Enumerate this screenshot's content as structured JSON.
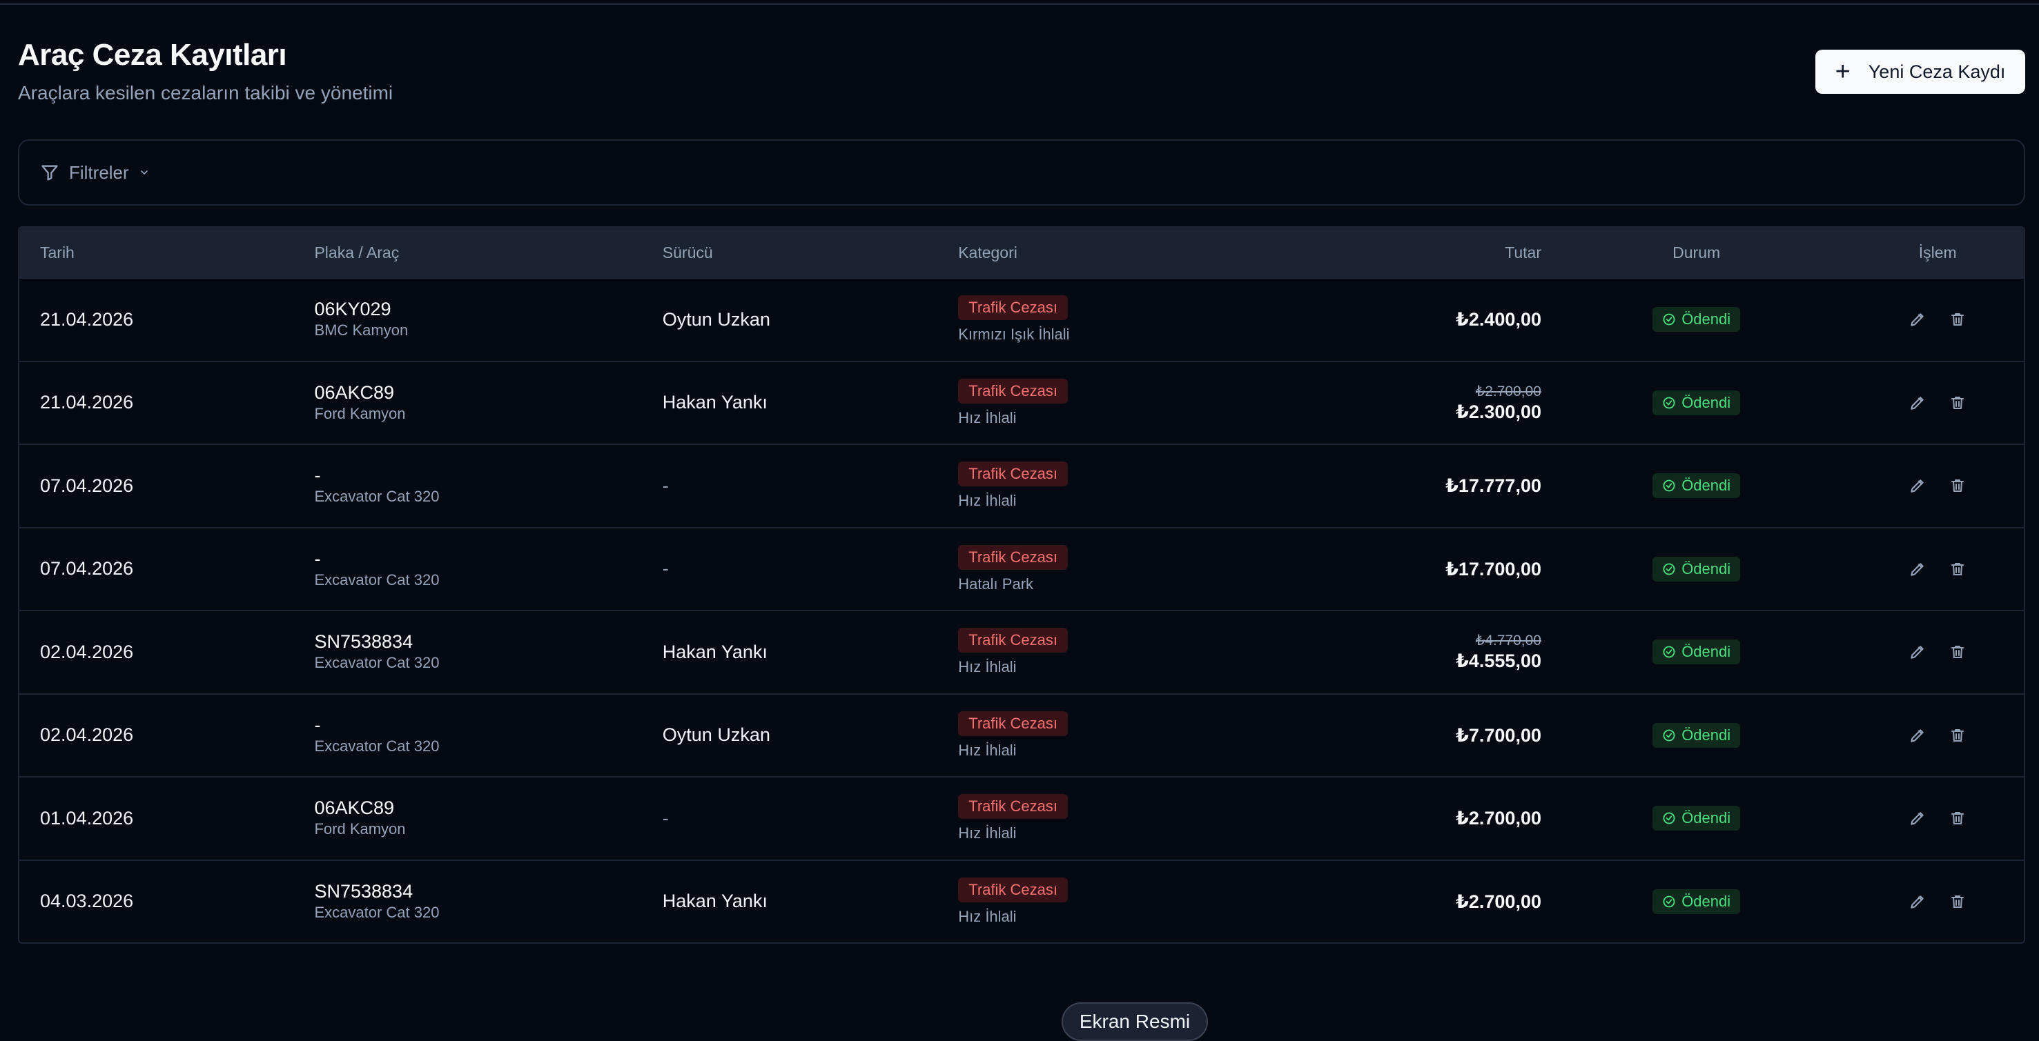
{
  "header": {
    "title": "Araç Ceza Kayıtları",
    "subtitle": "Araçlara kesilen cezaların takibi ve yönetimi",
    "new_button_label": "Yeni Ceza Kaydı"
  },
  "filters": {
    "label": "Filtreler"
  },
  "table": {
    "columns": [
      "Tarih",
      "Plaka / Araç",
      "Sürücü",
      "Kategori",
      "Tutar",
      "Durum",
      "İşlem"
    ],
    "rows": [
      {
        "date": "21.04.2026",
        "plate": "06KY029",
        "vehicle": "BMC Kamyon",
        "driver": "Oytun Uzkan",
        "category": "Trafik Cezası",
        "reason": "Kırmızı Işık İhlali",
        "old_amount": "",
        "amount": "₺2.400,00",
        "status": "Ödendi"
      },
      {
        "date": "21.04.2026",
        "plate": "06AKC89",
        "vehicle": "Ford Kamyon",
        "driver": "Hakan Yankı",
        "category": "Trafik Cezası",
        "reason": "Hız İhlali",
        "old_amount": "₺2.700,00",
        "amount": "₺2.300,00",
        "status": "Ödendi"
      },
      {
        "date": "07.04.2026",
        "plate": "-",
        "vehicle": "Excavator Cat 320",
        "driver": "-",
        "category": "Trafik Cezası",
        "reason": "Hız İhlali",
        "old_amount": "",
        "amount": "₺17.777,00",
        "status": "Ödendi"
      },
      {
        "date": "07.04.2026",
        "plate": "-",
        "vehicle": "Excavator Cat 320",
        "driver": "-",
        "category": "Trafik Cezası",
        "reason": "Hatalı Park",
        "old_amount": "",
        "amount": "₺17.700,00",
        "status": "Ödendi"
      },
      {
        "date": "02.04.2026",
        "plate": "SN7538834",
        "vehicle": "Excavator Cat 320",
        "driver": "Hakan Yankı",
        "category": "Trafik Cezası",
        "reason": "Hız İhlali",
        "old_amount": "₺4.770,00",
        "amount": "₺4.555,00",
        "status": "Ödendi"
      },
      {
        "date": "02.04.2026",
        "plate": "-",
        "vehicle": "Excavator Cat 320",
        "driver": "Oytun Uzkan",
        "category": "Trafik Cezası",
        "reason": "Hız İhlali",
        "old_amount": "",
        "amount": "₺7.700,00",
        "status": "Ödendi"
      },
      {
        "date": "01.04.2026",
        "plate": "06AKC89",
        "vehicle": "Ford Kamyon",
        "driver": "-",
        "category": "Trafik Cezası",
        "reason": "Hız İhlali",
        "old_amount": "",
        "amount": "₺2.700,00",
        "status": "Ödendi"
      },
      {
        "date": "04.03.2026",
        "plate": "SN7538834",
        "vehicle": "Excavator Cat 320",
        "driver": "Hakan Yankı",
        "category": "Trafik Cezası",
        "reason": "Hız İhlali",
        "old_amount": "",
        "amount": "₺2.700,00",
        "status": "Ödendi"
      }
    ]
  },
  "footer": {
    "screenshot_label": "Ekran Resmi"
  },
  "colors": {
    "background": "#050912",
    "header_row": "#1b2232",
    "category_badge_bg": "#3a1318",
    "category_badge_text": "#f87171",
    "status_badge_bg": "#0f2a1c",
    "status_badge_text": "#4ade80"
  },
  "icons": {
    "new_button": "plus-icon",
    "filter": "filter-funnel-icon",
    "filter_toggle": "chevron-down-icon",
    "status": "check-circle-icon",
    "edit": "pencil-icon",
    "delete": "trash-icon"
  }
}
